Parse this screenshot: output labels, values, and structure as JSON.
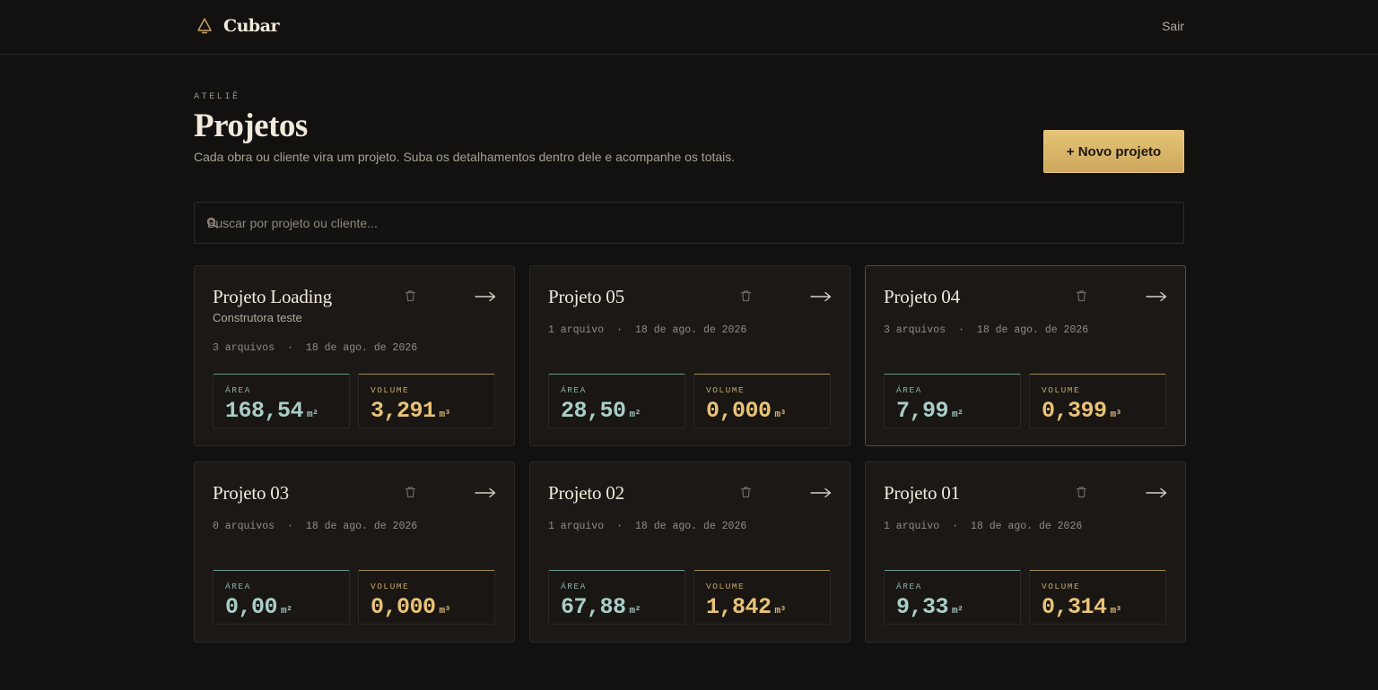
{
  "app": {
    "name": "Cubar",
    "logout_label": "Sair"
  },
  "header": {
    "eyebrow": "ATELIÊ",
    "title": "Projetos",
    "subtitle": "Cada obra ou cliente vira um projeto. Suba os detalhamentos dentro dele e acompanhe os totais.",
    "new_button": "+ Novo projeto"
  },
  "search": {
    "placeholder": "Buscar por projeto ou cliente..."
  },
  "labels": {
    "area": "ÁREA",
    "volume": "VOLUME",
    "area_unit": "m²",
    "volume_unit": "m³",
    "separator": "·"
  },
  "projects": [
    {
      "name": "Projeto Loading",
      "client": "Construtora teste",
      "files": "3 arquivos",
      "date": "18 de ago. de 2026",
      "area": "168,54",
      "volume": "3,291"
    },
    {
      "name": "Projeto 05",
      "client": "",
      "files": "1 arquivo",
      "date": "18 de ago. de 2026",
      "area": "28,50",
      "volume": "0,000"
    },
    {
      "name": "Projeto 04",
      "client": "",
      "files": "3 arquivos",
      "date": "18 de ago. de 2026",
      "area": "7,99",
      "volume": "0,399"
    },
    {
      "name": "Projeto 03",
      "client": "",
      "files": "0 arquivos",
      "date": "18 de ago. de 2026",
      "area": "0,00",
      "volume": "0,000"
    },
    {
      "name": "Projeto 02",
      "client": "",
      "files": "1 arquivo",
      "date": "18 de ago. de 2026",
      "area": "67,88",
      "volume": "1,842"
    },
    {
      "name": "Projeto 01",
      "client": "",
      "files": "1 arquivo",
      "date": "18 de ago. de 2026",
      "area": "9,33",
      "volume": "0,314"
    }
  ],
  "colors": {
    "accent_gold": "#d9b56a",
    "accent_teal": "#8cb1ac",
    "background": "#131110",
    "card": "#1b1816"
  },
  "icons": {
    "logo": "triangle-bell-icon",
    "search": "search-icon",
    "delete": "trash-icon",
    "open": "arrow-right-icon"
  }
}
